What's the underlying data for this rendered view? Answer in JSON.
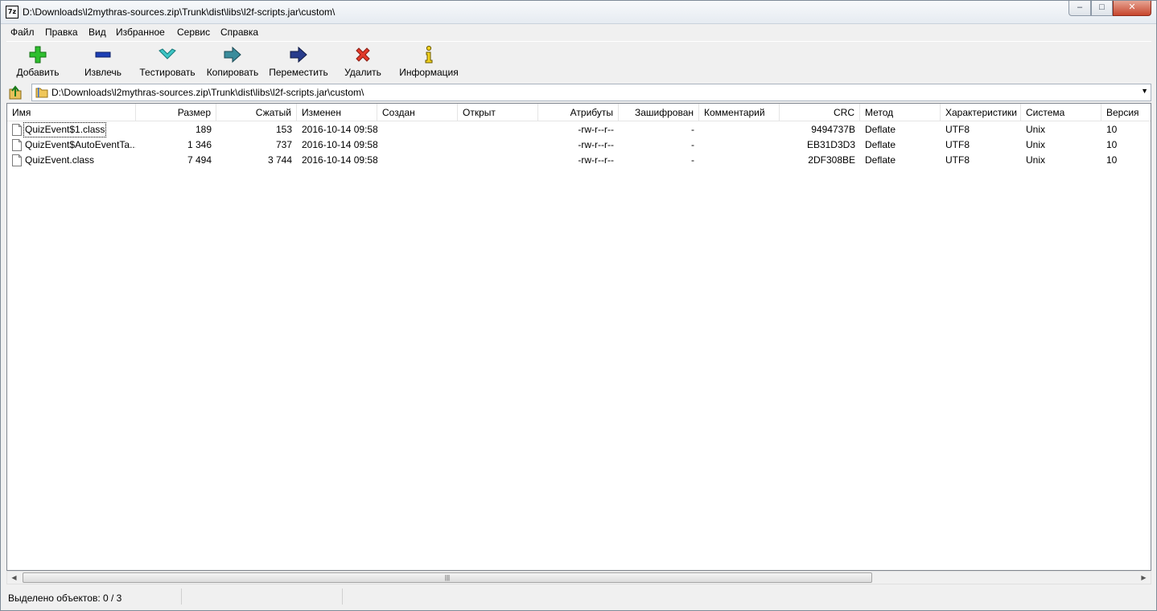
{
  "window": {
    "title": "D:\\Downloads\\l2mythras-sources.zip\\Trunk\\dist\\libs\\l2f-scripts.jar\\custom\\",
    "app_icon_text": "7z",
    "controls": {
      "minimize": "–",
      "maximize": "□",
      "close": "✕"
    }
  },
  "menu": [
    "Файл",
    "Правка",
    "Вид",
    "Избранное",
    "Сервис",
    "Справка"
  ],
  "toolbar": {
    "add": "Добавить",
    "extract": "Извлечь",
    "test": "Тестировать",
    "copy": "Копировать",
    "move": "Переместить",
    "delete": "Удалить",
    "info": "Информация"
  },
  "address": {
    "path": "D:\\Downloads\\l2mythras-sources.zip\\Trunk\\dist\\libs\\l2f-scripts.jar\\custom\\",
    "dropdown_icon": "▼"
  },
  "columns": {
    "name": "Имя",
    "size": "Размер",
    "packed": "Сжатый",
    "modified": "Изменен",
    "created": "Создан",
    "accessed": "Открыт",
    "attributes": "Атрибуты",
    "encrypted": "Зашифрован",
    "comment": "Комментарий",
    "crc": "CRC",
    "method": "Метод",
    "characteristics": "Характеристики",
    "host_os": "Система",
    "version": "Версия"
  },
  "files": [
    {
      "name": "QuizEvent$1.class",
      "size": "189",
      "packed": "153",
      "modified": "2016-10-14 09:58",
      "created": "",
      "accessed": "",
      "attributes": "-rw-r--r--",
      "encrypted": "-",
      "comment": "",
      "crc": "9494737B",
      "method": "Deflate",
      "characteristics": "UTF8",
      "host_os": "Unix",
      "version": "10"
    },
    {
      "name": "QuizEvent$AutoEventTa...",
      "size": "1 346",
      "packed": "737",
      "modified": "2016-10-14 09:58",
      "created": "",
      "accessed": "",
      "attributes": "-rw-r--r--",
      "encrypted": "-",
      "comment": "",
      "crc": "EB31D3D3",
      "method": "Deflate",
      "characteristics": "UTF8",
      "host_os": "Unix",
      "version": "10"
    },
    {
      "name": "QuizEvent.class",
      "size": "7 494",
      "packed": "3 744",
      "modified": "2016-10-14 09:58",
      "created": "",
      "accessed": "",
      "attributes": "-rw-r--r--",
      "encrypted": "-",
      "comment": "",
      "crc": "2DF308BE",
      "method": "Deflate",
      "characteristics": "UTF8",
      "host_os": "Unix",
      "version": "10"
    }
  ],
  "scrollbar": {
    "left": "◀",
    "right": "▶",
    "grip": "|||"
  },
  "status": {
    "selected": "Выделено объектов: 0 / 3"
  }
}
